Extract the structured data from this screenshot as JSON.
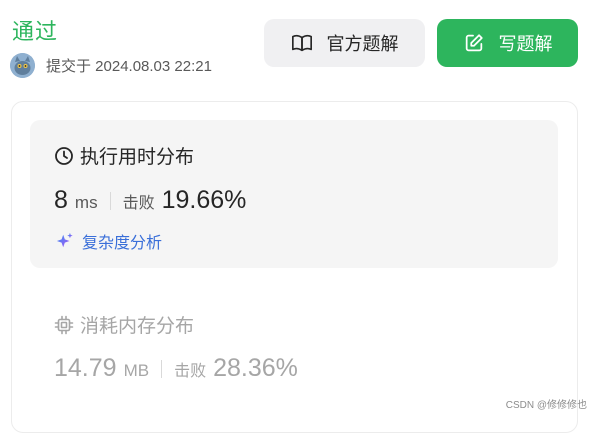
{
  "header": {
    "status": "通过",
    "submit_text": "提交于 2024.08.03 22:21"
  },
  "buttons": {
    "official_solution": "官方题解",
    "write_solution": "写题解"
  },
  "runtime": {
    "title": "执行用时分布",
    "value": "8",
    "unit": "ms",
    "beat_label": "击败",
    "beat_percent": "19.66%",
    "complexity_label": "复杂度分析"
  },
  "memory": {
    "title": "消耗内存分布",
    "value": "14.79",
    "unit": "MB",
    "beat_label": "击败",
    "beat_percent": "28.36%"
  },
  "watermark": "CSDN @修修修也",
  "colors": {
    "accent_green": "#2db55d",
    "complexity_blue": "#3a6fd9",
    "sparkle_purple": "#8b5cf6"
  }
}
